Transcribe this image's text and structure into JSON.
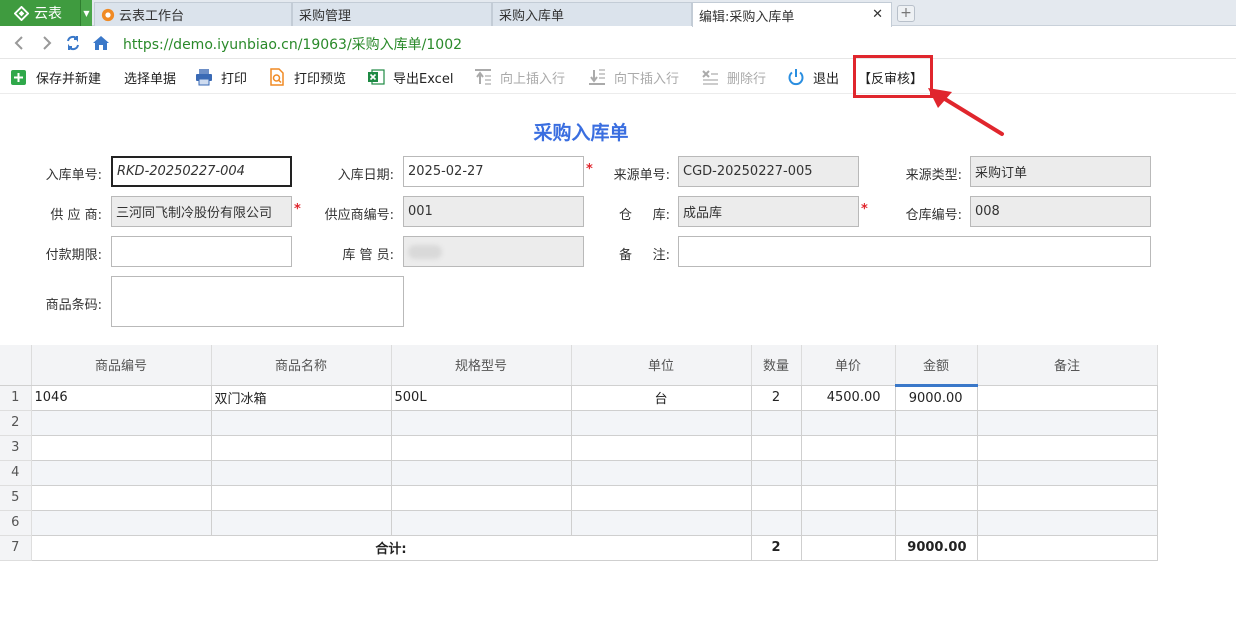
{
  "app": {
    "name": "云表"
  },
  "tabs": [
    {
      "label": "云表工作台"
    },
    {
      "label": "采购管理"
    },
    {
      "label": "采购入库单"
    },
    {
      "label": "编辑:采购入库单"
    }
  ],
  "address": {
    "url": "https://demo.iyunbiao.cn/19063/采购入库单/1002"
  },
  "toolbar": {
    "save_new": "保存并新建",
    "select_doc": "选择单据",
    "print": "打印",
    "print_preview": "打印预览",
    "export_excel": "导出Excel",
    "insert_above": "向上插入行",
    "insert_below": "向下插入行",
    "delete_row": "删除行",
    "exit": "退出",
    "unapprove": "【反审核】"
  },
  "form": {
    "title": "采购入库单",
    "receipt_no_label": "入库单号:",
    "receipt_no": "RKD-20250227-004",
    "receipt_date_label": "入库日期:",
    "receipt_date": "2025-02-27",
    "source_no_label": "来源单号:",
    "source_no": "CGD-20250227-005",
    "source_type_label": "来源类型:",
    "source_type": "采购订单",
    "supplier_label": "供 应 商:",
    "supplier": "三河同飞制冷股份有限公司",
    "supplier_code_label": "供应商编号:",
    "supplier_code": "001",
    "warehouse_label": "仓     库:",
    "warehouse": "成品库",
    "warehouse_code_label": "仓库编号:",
    "warehouse_code": "008",
    "payment_term_label": "付款期限:",
    "payment_term": "",
    "keeper_label": "库 管 员:",
    "remark_label": "备     注:",
    "remark": "",
    "barcode_label": "商品条码:",
    "barcode": "",
    "required_mark": "*"
  },
  "grid": {
    "columns": [
      "商品编号",
      "商品名称",
      "规格型号",
      "单位",
      "数量",
      "单价",
      "金额",
      "备注"
    ],
    "rows": [
      {
        "num": "1",
        "code": "1046",
        "name": "双门冰箱",
        "spec": "500L",
        "unit": "台",
        "qty": "2",
        "price": "4500.00",
        "amount": "9000.00",
        "remark": ""
      },
      {
        "num": "2"
      },
      {
        "num": "3"
      },
      {
        "num": "4"
      },
      {
        "num": "5"
      },
      {
        "num": "6"
      }
    ],
    "total": {
      "num": "7",
      "label": "合计:",
      "qty": "2",
      "amount": "9000.00"
    }
  },
  "colors": {
    "accent": "#3a6ee0",
    "brand_green": "#3f9b3f",
    "highlight_red": "#e0262d"
  }
}
